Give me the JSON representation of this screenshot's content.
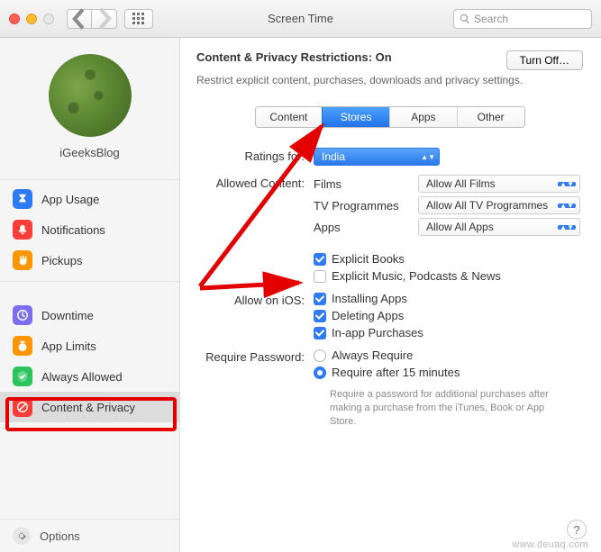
{
  "window": {
    "title": "Screen Time"
  },
  "search": {
    "placeholder": "Search"
  },
  "profile": {
    "name": "iGeeksBlog"
  },
  "sidebar": {
    "group1": [
      {
        "label": "App Usage"
      },
      {
        "label": "Notifications"
      },
      {
        "label": "Pickups"
      }
    ],
    "group2": [
      {
        "label": "Downtime"
      },
      {
        "label": "App Limits"
      },
      {
        "label": "Always Allowed"
      },
      {
        "label": "Content & Privacy"
      }
    ],
    "footer": "Options"
  },
  "header": {
    "title_prefix": "Content & Privacy Restrictions: ",
    "status": "On",
    "turn_off": "Turn Off…",
    "subhead": "Restrict explicit content, purchases, downloads and privacy settings."
  },
  "tabs": [
    "Content",
    "Stores",
    "Apps",
    "Other"
  ],
  "form": {
    "ratings_label": "Ratings for:",
    "ratings_value": "India",
    "allowed_label": "Allowed Content:",
    "allowed_rows": [
      {
        "name": "Films",
        "value": "Allow All Films"
      },
      {
        "name": "TV Programmes",
        "value": "Allow All TV Programmes"
      },
      {
        "name": "Apps",
        "value": "Allow All Apps"
      }
    ],
    "explicit_books": "Explicit Books",
    "explicit_music": "Explicit Music, Podcasts & News",
    "ios_label": "Allow on iOS:",
    "ios_items": [
      "Installing Apps",
      "Deleting Apps",
      "In-app Purchases"
    ],
    "pw_label": "Require Password:",
    "pw_opts": [
      "Always Require",
      "Require after 15 minutes"
    ],
    "pw_hint": "Require a password for additional purchases after making a purchase from the iTunes, Book or App Store."
  },
  "watermark": "www.deuaq.com"
}
